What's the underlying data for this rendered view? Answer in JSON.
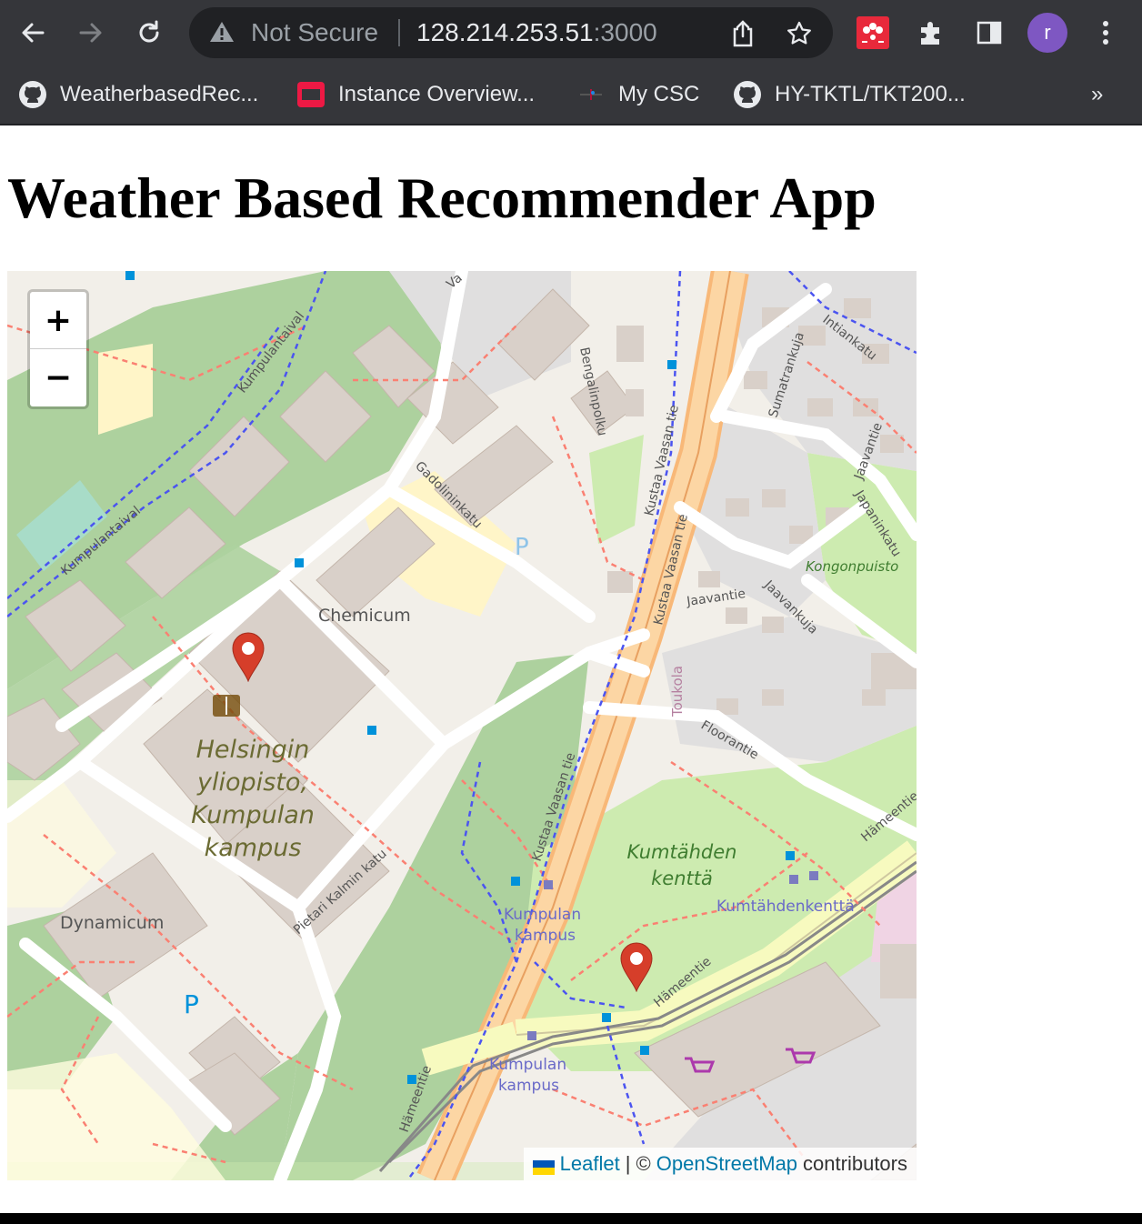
{
  "browser": {
    "security_label": "Not Secure",
    "url_host": "128.214.253.51",
    "url_port": ":3000",
    "profile_initial": "r",
    "bookmarks": [
      {
        "label": "WeatherbasedRec...",
        "icon": "github-icon"
      },
      {
        "label": "Instance Overview...",
        "icon": "openstack-icon"
      },
      {
        "label": "My CSC",
        "icon": "csc-icon"
      },
      {
        "label": "HY-TKTL/TKT200...",
        "icon": "github-icon"
      }
    ],
    "more_bookmarks": "»"
  },
  "page": {
    "title": "Weather Based Recommender App"
  },
  "map": {
    "zoom_in_label": "+",
    "zoom_out_label": "−",
    "attribution": {
      "leaflet": "Leaflet",
      "separator": "| ©",
      "osm": "OpenStreetMap",
      "suffix": "contributors"
    },
    "labels": {
      "kumpulantaival": "Kumpulantaival",
      "gadolininkatu": "Gadolininkatu",
      "bengalinpolku": "Bengalinpolku",
      "kustaa1": "Kustaa Vaasan tie",
      "kustaa2": "Kustaa Vaasan tie",
      "kustaa3": "Kustaa Vaasan tie",
      "sumatrankuja": "Sumatrankuja",
      "intiankatu": "Intiankatu",
      "jaavantie": "Jaavantie",
      "japaninkatu": "Japaninkatu",
      "kongonpuisto": "Kongonpuisto",
      "jaavankuja": "Jaavankuja",
      "chemicum": "Chemicum",
      "toukola": "Toukola",
      "floorantie": "Floorantie",
      "uni1": "Helsingin",
      "uni2": "yliopisto,",
      "uni3": "Kumpulan",
      "uni4": "kampus",
      "kumtahden1": "Kumtähden",
      "kumtahden2": "kenttä",
      "kumtahdenkentta": "Kumtähdenkenttä",
      "hameentie": "Hämeentie",
      "dynamicum": "Dynamicum",
      "pietari": "Pietari Kalmin katu",
      "stop1a": "Kumpulan",
      "stop1b": "kampus",
      "stop2a": "Kumpulan",
      "stop2b": "kampus",
      "parking": "P",
      "vaasa_top": "Va"
    },
    "markers": [
      {
        "name": "marker-campus",
        "color": "#d63e2a"
      },
      {
        "name": "marker-kumtahden",
        "color": "#d63e2a"
      }
    ]
  }
}
